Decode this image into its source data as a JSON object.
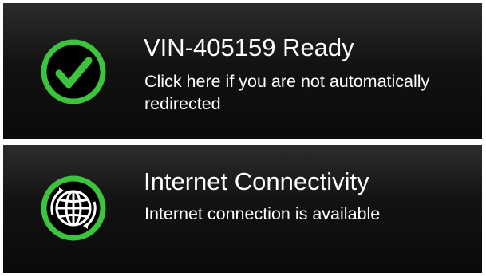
{
  "colors": {
    "accent_green": "#3cc43c",
    "panel_background": "#141414",
    "text": "#ffffff"
  },
  "notifications": [
    {
      "icon": "checkmark-circle-icon",
      "title": "VIN-405159 Ready",
      "subtitle": "Click here if you are not automatically redirected"
    },
    {
      "icon": "globe-icon",
      "title": "Internet Connectivity",
      "subtitle": "Internet connection is available"
    }
  ]
}
